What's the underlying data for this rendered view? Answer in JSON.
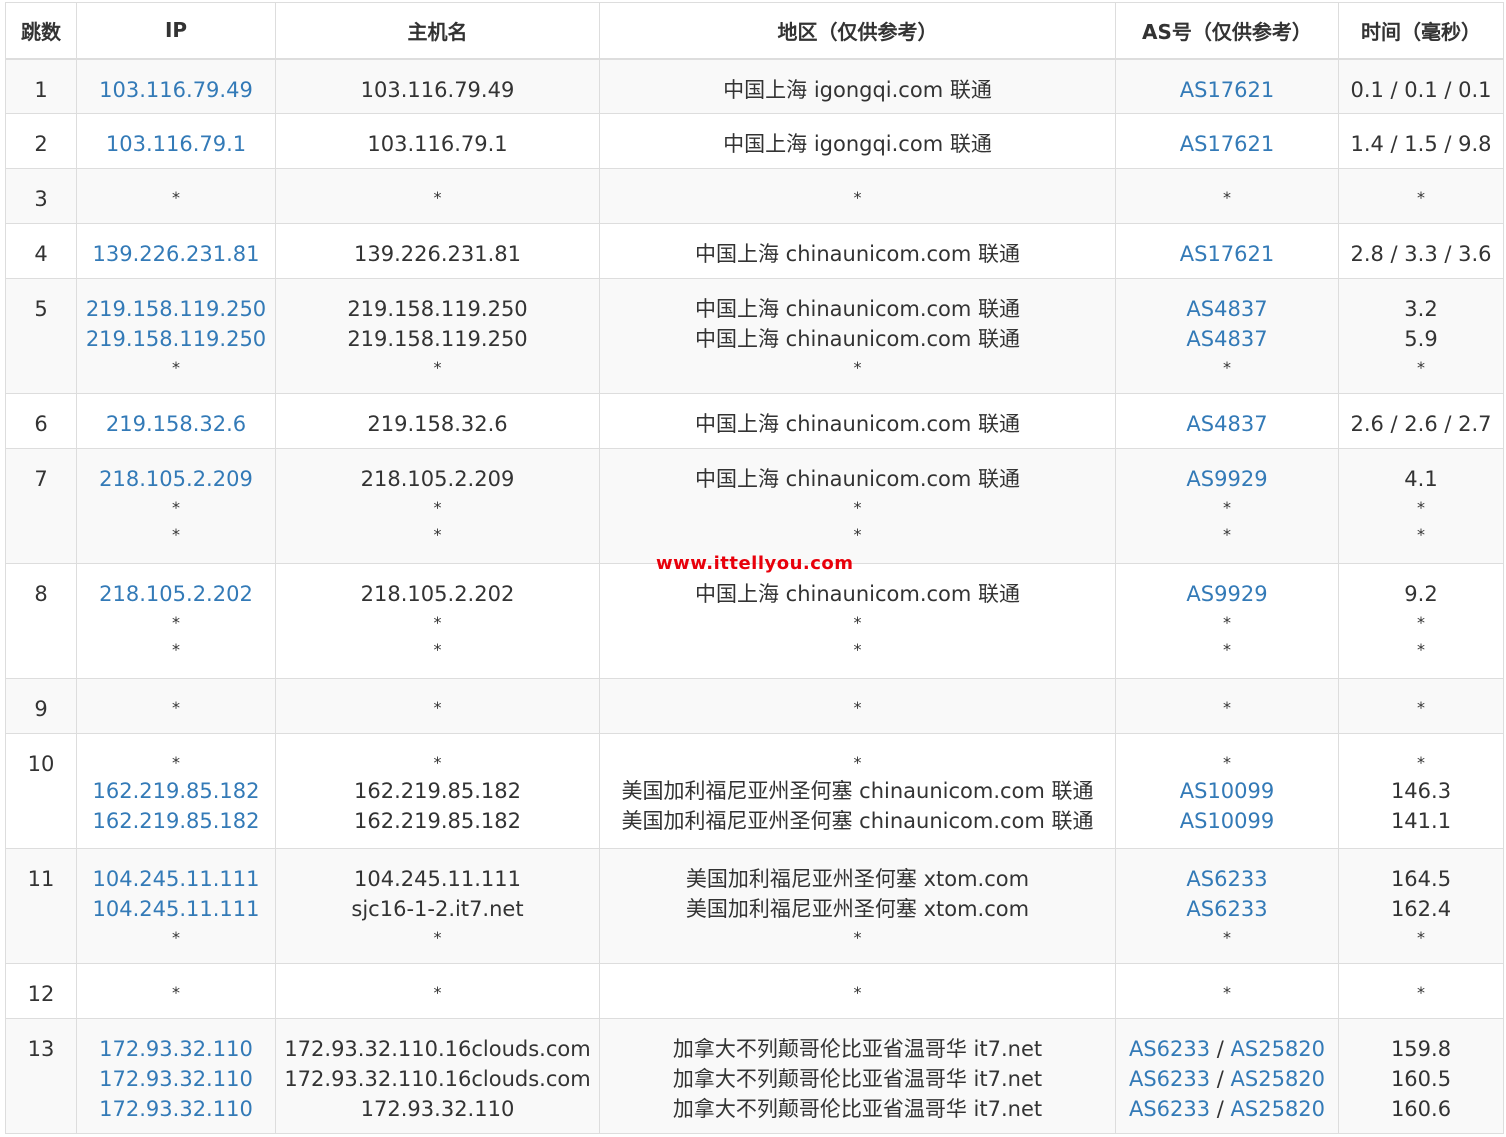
{
  "table": {
    "headers": [
      "跳数",
      "IP",
      "主机名",
      "地区（仅供参考）",
      "AS号（仅供参考）",
      "时间（毫秒）"
    ],
    "rows": [
      {
        "hop": "1",
        "row_height": 55,
        "lines": [
          {
            "ip": "103.116.79.49",
            "host": "103.116.79.49",
            "region": "中国上海 igongqi.com 联通",
            "asn": [
              "AS17621"
            ],
            "time": "0.1 / 0.1 / 0.1"
          }
        ]
      },
      {
        "hop": "2",
        "lines": [
          {
            "ip": "103.116.79.1",
            "host": "103.116.79.1",
            "region": "中国上海 igongqi.com 联通",
            "asn": [
              "AS17621"
            ],
            "time": "1.4 / 1.5 / 9.8"
          }
        ]
      },
      {
        "hop": "3",
        "lines": [
          {
            "ip": "*",
            "host": "*",
            "region": "*",
            "asn": [
              "*"
            ],
            "time": "*"
          }
        ]
      },
      {
        "hop": "4",
        "lines": [
          {
            "ip": "139.226.231.81",
            "host": "139.226.231.81",
            "region": "中国上海 chinaunicom.com 联通",
            "asn": [
              "AS17621"
            ],
            "time": "2.8 / 3.3 / 3.6"
          }
        ]
      },
      {
        "hop": "5",
        "lines": [
          {
            "ip": "219.158.119.250",
            "host": "219.158.119.250",
            "region": "中国上海 chinaunicom.com 联通",
            "asn": [
              "AS4837"
            ],
            "time": "3.2"
          },
          {
            "ip": "219.158.119.250",
            "host": "219.158.119.250",
            "region": "中国上海 chinaunicom.com 联通",
            "asn": [
              "AS4837"
            ],
            "time": "5.9"
          },
          {
            "ip": "*",
            "host": "*",
            "region": "*",
            "asn": [
              "*"
            ],
            "time": "*"
          }
        ]
      },
      {
        "hop": "6",
        "lines": [
          {
            "ip": "219.158.32.6",
            "host": "219.158.32.6",
            "region": "中国上海 chinaunicom.com 联通",
            "asn": [
              "AS4837"
            ],
            "time": "2.6 / 2.6 / 2.7"
          }
        ]
      },
      {
        "hop": "7",
        "lines": [
          {
            "ip": "218.105.2.209",
            "host": "218.105.2.209",
            "region": "中国上海 chinaunicom.com 联通",
            "asn": [
              "AS9929"
            ],
            "time": "4.1"
          },
          {
            "ip": "*",
            "host": "*",
            "region": "*",
            "asn": [
              "*"
            ],
            "time": "*"
          },
          {
            "ip": "*",
            "host": "*",
            "region": "*",
            "asn": [
              "*"
            ],
            "time": "*"
          }
        ]
      },
      {
        "hop": "8",
        "lines": [
          {
            "ip": "218.105.2.202",
            "host": "218.105.2.202",
            "region": "中国上海 chinaunicom.com 联通",
            "asn": [
              "AS9929"
            ],
            "time": "9.2"
          },
          {
            "ip": "*",
            "host": "*",
            "region": "*",
            "asn": [
              "*"
            ],
            "time": "*"
          },
          {
            "ip": "*",
            "host": "*",
            "region": "*",
            "asn": [
              "*"
            ],
            "time": "*"
          }
        ]
      },
      {
        "hop": "9",
        "lines": [
          {
            "ip": "*",
            "host": "*",
            "region": "*",
            "asn": [
              "*"
            ],
            "time": "*"
          }
        ]
      },
      {
        "hop": "10",
        "lines": [
          {
            "ip": "*",
            "host": "*",
            "region": "*",
            "asn": [
              "*"
            ],
            "time": "*"
          },
          {
            "ip": "162.219.85.182",
            "host": "162.219.85.182",
            "region": "美国加利福尼亚州圣何塞 chinaunicom.com 联通",
            "asn": [
              "AS10099"
            ],
            "time": "146.3"
          },
          {
            "ip": "162.219.85.182",
            "host": "162.219.85.182",
            "region": "美国加利福尼亚州圣何塞 chinaunicom.com 联通",
            "asn": [
              "AS10099"
            ],
            "time": "141.1"
          }
        ]
      },
      {
        "hop": "11",
        "lines": [
          {
            "ip": "104.245.11.111",
            "host": "104.245.11.111",
            "region": "美国加利福尼亚州圣何塞 xtom.com",
            "asn": [
              "AS6233"
            ],
            "time": "164.5"
          },
          {
            "ip": "104.245.11.111",
            "host": "sjc16-1-2.it7.net",
            "region": "美国加利福尼亚州圣何塞 xtom.com",
            "asn": [
              "AS6233"
            ],
            "time": "162.4"
          },
          {
            "ip": "*",
            "host": "*",
            "region": "*",
            "asn": [
              "*"
            ],
            "time": "*"
          }
        ]
      },
      {
        "hop": "12",
        "lines": [
          {
            "ip": "*",
            "host": "*",
            "region": "*",
            "asn": [
              "*"
            ],
            "time": "*"
          }
        ]
      },
      {
        "hop": "13",
        "lines": [
          {
            "ip": "172.93.32.110",
            "host": "172.93.32.110.16clouds.com",
            "region": "加拿大不列颠哥伦比亚省温哥华 it7.net",
            "asn": [
              "AS6233",
              "AS25820"
            ],
            "time": "159.8"
          },
          {
            "ip": "172.93.32.110",
            "host": "172.93.32.110.16clouds.com",
            "region": "加拿大不列颠哥伦比亚省温哥华 it7.net",
            "asn": [
              "AS6233",
              "AS25820"
            ],
            "time": "160.5"
          },
          {
            "ip": "172.93.32.110",
            "host": "172.93.32.110",
            "region": "加拿大不列颠哥伦比亚省温哥华 it7.net",
            "asn": [
              "AS6233",
              "AS25820"
            ],
            "time": "160.6"
          }
        ]
      }
    ]
  },
  "watermark": "www.ittellyou.com",
  "colors": {
    "link": "#337ab7",
    "text": "#333333",
    "border": "#dddddd",
    "stripe": "#f9f9f9",
    "watermark": "#e8000b"
  }
}
